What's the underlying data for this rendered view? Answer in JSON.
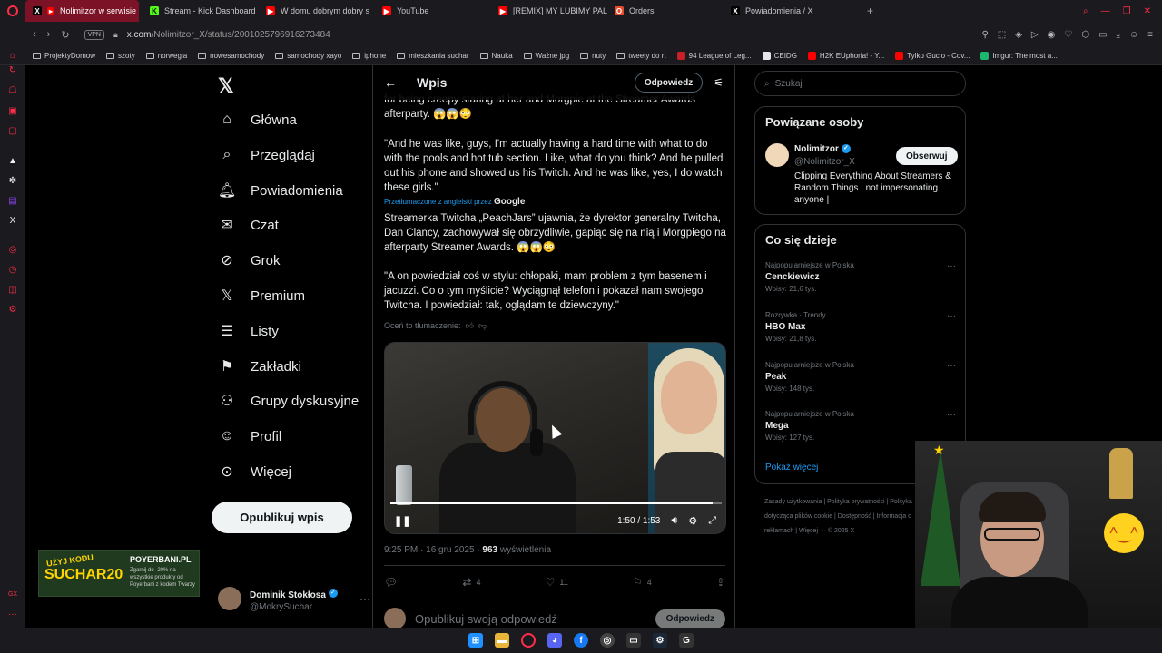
{
  "browser": {
    "tabs": [
      {
        "label": "Nolimitzor w serwisie",
        "icon": "x-favicon",
        "active": true
      },
      {
        "label": "Stream - Kick Dashboard",
        "icon": "kick-favicon",
        "active": false
      },
      {
        "label": "W domu dobrym dobry s",
        "icon": "youtube-favicon",
        "active": false
      },
      {
        "label": "YouTube",
        "icon": "youtube-favicon",
        "active": false
      },
      {
        "label": "[REMIX] MY LUBIMY PAL",
        "icon": "youtube-favicon",
        "active": false
      },
      {
        "label": "Orders",
        "icon": "orders-favicon",
        "active": false
      },
      {
        "label": "Powiadomienia / X",
        "icon": "x-favicon",
        "active": false
      }
    ],
    "vpn_label": "VPN",
    "url_host": "x.com",
    "url_path": "/Nolimitzor_X/status/2001025796916273484",
    "bookmarks": [
      {
        "label": "ProjektyDomow",
        "icon": "folder"
      },
      {
        "label": "szoty",
        "icon": "folder"
      },
      {
        "label": "norwegia",
        "icon": "folder"
      },
      {
        "label": "nowesamochody",
        "icon": "folder"
      },
      {
        "label": "samochody xayo",
        "icon": "folder"
      },
      {
        "label": "iphone",
        "icon": "folder"
      },
      {
        "label": "mieszkania suchar",
        "icon": "folder"
      },
      {
        "label": "Nauka",
        "icon": "folder"
      },
      {
        "label": "Ważne jpg",
        "icon": "folder"
      },
      {
        "label": "nuty",
        "icon": "folder"
      },
      {
        "label": "tweety do rt",
        "icon": "folder"
      },
      {
        "label": "94 League of Leg...",
        "icon": "lol-favicon"
      },
      {
        "label": "CEIDG",
        "icon": "ceidg-favicon"
      },
      {
        "label": "H2K EUphoria! - Y...",
        "icon": "youtube-favicon"
      },
      {
        "label": "Tylko Gucio - Cov...",
        "icon": "youtube-favicon"
      },
      {
        "label": "Imgur: The most a...",
        "icon": "imgur-favicon"
      }
    ]
  },
  "xnav": {
    "items": [
      {
        "label": "Główna",
        "icon": "home-icon"
      },
      {
        "label": "Przeglądaj",
        "icon": "search-icon"
      },
      {
        "label": "Powiadomienia",
        "icon": "bell-icon"
      },
      {
        "label": "Czat",
        "icon": "mail-icon"
      },
      {
        "label": "Grok",
        "icon": "grok-icon"
      },
      {
        "label": "Premium",
        "icon": "x-premium-icon"
      },
      {
        "label": "Listy",
        "icon": "list-icon"
      },
      {
        "label": "Zakładki",
        "icon": "bookmark-icon"
      },
      {
        "label": "Grupy dyskusyjne",
        "icon": "people-icon"
      },
      {
        "label": "Profil",
        "icon": "person-icon"
      },
      {
        "label": "Więcej",
        "icon": "more-circle-icon"
      }
    ],
    "publish_label": "Opublikuj wpis",
    "profile_name": "Dominik Stokłosa",
    "profile_handle": "@MokrySuchar"
  },
  "promo": {
    "tag": "UŻYJ KODU",
    "code": "SUCHAR20",
    "brand": "POYERBANI.PL",
    "text": "Zgarnij do -20% na wszystkie produkty od Poyerbani z kodem Twarzy"
  },
  "main": {
    "title": "Wpis",
    "reply_button": "Odpowiedz",
    "text_top": "for being creepy staring at her and Morgpie at the Streamer Awards afterparty. 😱😱😳",
    "text_quote_en": "\"And he was like, guys, I'm actually having a hard time with what to do with the pools and hot tub section. Like, what do you think? And he pulled out his phone and showed us his Twitch. And he was like, yes, I do watch these girls.\"",
    "translated_by": "Przetłumaczone z angielski przez",
    "translator": "Google",
    "text_pl_1": "Streamerka Twitcha „PeachJars” ujawnia, że dyrektor generalny Twitcha, Dan Clancy, zachowywał się obrzydliwie, gapiąc się na nią i Morgpiego na afterparty Streamer Awards. 😱😱😳",
    "text_pl_2": "\"A on powiedział coś w stylu: chłopaki, mam problem z tym basenem i jacuzzi. Co o tym myślicie? Wyciągnął telefon i pokazał nam swojego Twitcha. I powiedział: tak, oglądam te dziewczyny.\"",
    "rate_translation": "Oceń to tłumaczenie:",
    "video": {
      "time": "1:50 / 1:53",
      "progress": 0.973
    },
    "timestamp": "9:25 PM · 16 gru 2025 · ",
    "views_count": "963",
    "views_label": " wyświetlenia",
    "actions": {
      "reposts": "4",
      "likes": "11",
      "bookmarks": "4"
    },
    "reply_placeholder": "Opublikuj swoją odpowiedź",
    "reply_submit": "Odpowiedz"
  },
  "right": {
    "search_placeholder": "Szukaj",
    "related_title": "Powiązane osoby",
    "related": {
      "name": "Nolimitzor",
      "handle": "@Nolimitzor_X",
      "follow": "Obserwuj",
      "bio": "Clipping Everything About Streamers & Random Things | not impersonating anyone |"
    },
    "trends_title": "Co się dzieje",
    "trends": [
      {
        "category": "Najpopularniejsze w Polska",
        "name": "Cenckiewicz",
        "posts": "Wpisy: 21,6 tys."
      },
      {
        "category": "Rozrywka · Trendy",
        "name": "HBO Max",
        "posts": "Wpisy: 21,8 tys."
      },
      {
        "category": "Najpopularniejsze w Polska",
        "name": "Peak",
        "posts": "Wpisy: 148 tys."
      },
      {
        "category": "Najpopularniejsze w Polska",
        "name": "Mega",
        "posts": "Wpisy: 127 tys."
      }
    ],
    "show_more": "Pokaż więcej",
    "footer": "Zasady użytkowania | Polityka prywatności | Polityka dotycząca plików cookie | Dostępność | Informacja o reklamach | Więcej ··· © 2025 X"
  }
}
